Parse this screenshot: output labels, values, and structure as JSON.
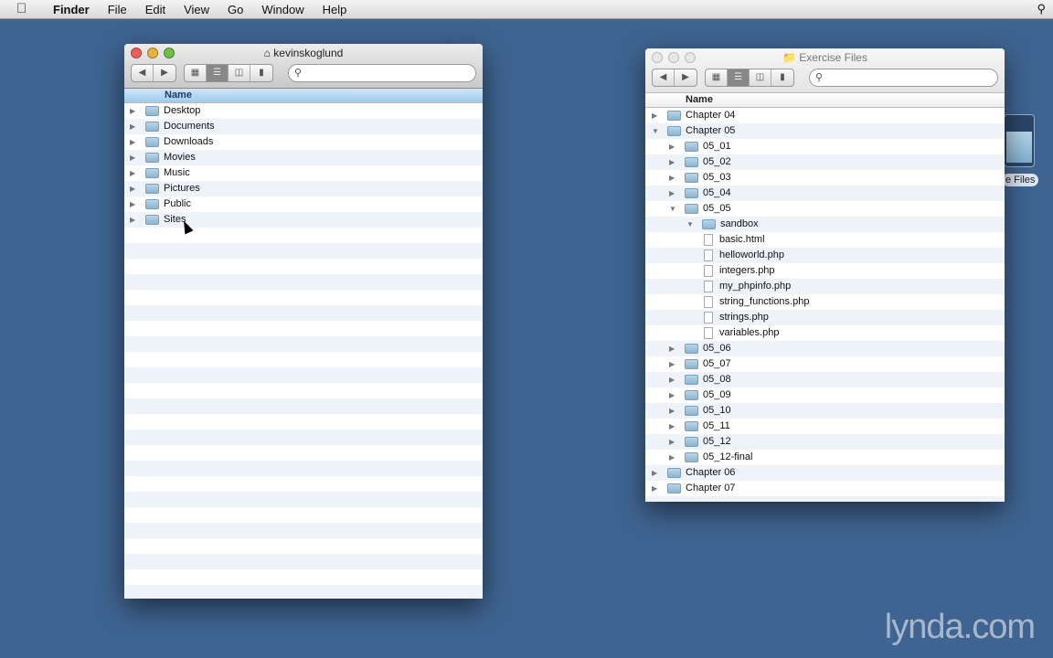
{
  "menubar": {
    "app": "Finder",
    "items": [
      "File",
      "Edit",
      "View",
      "Go",
      "Window",
      "Help"
    ]
  },
  "left_window": {
    "title": "kevinskoglund",
    "column": "Name",
    "items": [
      {
        "label": "Desktop",
        "level": 0,
        "kind": "folder",
        "expanded": false
      },
      {
        "label": "Documents",
        "level": 0,
        "kind": "folder",
        "expanded": false
      },
      {
        "label": "Downloads",
        "level": 0,
        "kind": "folder",
        "expanded": false
      },
      {
        "label": "Movies",
        "level": 0,
        "kind": "folder",
        "expanded": false
      },
      {
        "label": "Music",
        "level": 0,
        "kind": "folder",
        "expanded": false
      },
      {
        "label": "Pictures",
        "level": 0,
        "kind": "folder",
        "expanded": false
      },
      {
        "label": "Public",
        "level": 0,
        "kind": "folder",
        "expanded": false
      },
      {
        "label": "Sites",
        "level": 0,
        "kind": "folder",
        "expanded": false
      }
    ]
  },
  "right_window": {
    "title": "Exercise Files",
    "column": "Name",
    "items": [
      {
        "label": "Chapter 04",
        "level": 0,
        "kind": "folder",
        "expanded": false
      },
      {
        "label": "Chapter 05",
        "level": 0,
        "kind": "folder",
        "expanded": true
      },
      {
        "label": "05_01",
        "level": 1,
        "kind": "folder",
        "expanded": false
      },
      {
        "label": "05_02",
        "level": 1,
        "kind": "folder",
        "expanded": false
      },
      {
        "label": "05_03",
        "level": 1,
        "kind": "folder",
        "expanded": false
      },
      {
        "label": "05_04",
        "level": 1,
        "kind": "folder",
        "expanded": false
      },
      {
        "label": "05_05",
        "level": 1,
        "kind": "folder",
        "expanded": true
      },
      {
        "label": "sandbox",
        "level": 2,
        "kind": "folder",
        "expanded": true
      },
      {
        "label": "basic.html",
        "level": 3,
        "kind": "file"
      },
      {
        "label": "helloworld.php",
        "level": 3,
        "kind": "file"
      },
      {
        "label": "integers.php",
        "level": 3,
        "kind": "file"
      },
      {
        "label": "my_phpinfo.php",
        "level": 3,
        "kind": "file"
      },
      {
        "label": "string_functions.php",
        "level": 3,
        "kind": "file"
      },
      {
        "label": "strings.php",
        "level": 3,
        "kind": "file"
      },
      {
        "label": "variables.php",
        "level": 3,
        "kind": "file"
      },
      {
        "label": "05_06",
        "level": 1,
        "kind": "folder",
        "expanded": false
      },
      {
        "label": "05_07",
        "level": 1,
        "kind": "folder",
        "expanded": false
      },
      {
        "label": "05_08",
        "level": 1,
        "kind": "folder",
        "expanded": false
      },
      {
        "label": "05_09",
        "level": 1,
        "kind": "folder",
        "expanded": false
      },
      {
        "label": "05_10",
        "level": 1,
        "kind": "folder",
        "expanded": false
      },
      {
        "label": "05_11",
        "level": 1,
        "kind": "folder",
        "expanded": false
      },
      {
        "label": "05_12",
        "level": 1,
        "kind": "folder",
        "expanded": false
      },
      {
        "label": "05_12-final",
        "level": 1,
        "kind": "folder",
        "expanded": false
      },
      {
        "label": "Chapter 06",
        "level": 0,
        "kind": "folder",
        "expanded": false
      },
      {
        "label": "Chapter 07",
        "level": 0,
        "kind": "folder",
        "expanded": false
      }
    ]
  },
  "desktop_icon": {
    "label": "e Files"
  },
  "watermark": "lynda.com"
}
